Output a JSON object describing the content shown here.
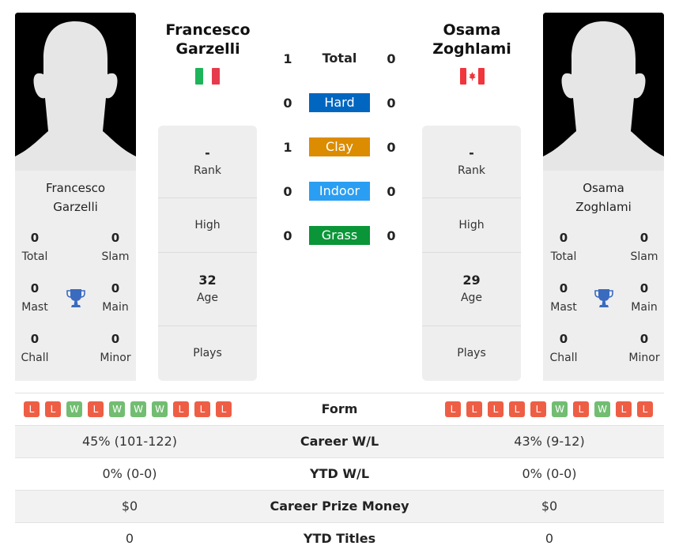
{
  "player1": {
    "first_name": "Francesco",
    "last_name": "Garzelli",
    "country": "Italy",
    "flag_icon": "italy-flag-icon",
    "titles": {
      "total": {
        "value": "0",
        "label": "Total"
      },
      "slam": {
        "value": "0",
        "label": "Slam"
      },
      "mast": {
        "value": "0",
        "label": "Mast"
      },
      "main": {
        "value": "0",
        "label": "Main"
      },
      "chall": {
        "value": "0",
        "label": "Chall"
      },
      "minor": {
        "value": "0",
        "label": "Minor"
      }
    },
    "rank": {
      "value": "-",
      "label": "Rank"
    },
    "high": {
      "value": "",
      "label": "High"
    },
    "age": {
      "value": "32",
      "label": "Age"
    },
    "plays": {
      "value": "",
      "label": "Plays"
    },
    "form": [
      "L",
      "L",
      "W",
      "L",
      "W",
      "W",
      "W",
      "L",
      "L",
      "L"
    ],
    "career_wl": "45% (101-122)",
    "ytd_wl": "0% (0-0)",
    "career_prize": "$0",
    "ytd_titles": "0"
  },
  "player2": {
    "first_name": "Osama",
    "last_name": "Zoghlami",
    "country": "Canada",
    "flag_icon": "canada-flag-icon",
    "titles": {
      "total": {
        "value": "0",
        "label": "Total"
      },
      "slam": {
        "value": "0",
        "label": "Slam"
      },
      "mast": {
        "value": "0",
        "label": "Mast"
      },
      "main": {
        "value": "0",
        "label": "Main"
      },
      "chall": {
        "value": "0",
        "label": "Chall"
      },
      "minor": {
        "value": "0",
        "label": "Minor"
      }
    },
    "rank": {
      "value": "-",
      "label": "Rank"
    },
    "high": {
      "value": "",
      "label": "High"
    },
    "age": {
      "value": "29",
      "label": "Age"
    },
    "plays": {
      "value": "",
      "label": "Plays"
    },
    "form": [
      "L",
      "L",
      "L",
      "L",
      "L",
      "W",
      "L",
      "W",
      "L",
      "L"
    ],
    "career_wl": "43% (9-12)",
    "ytd_wl": "0% (0-0)",
    "career_prize": "$0",
    "ytd_titles": "0"
  },
  "h2h": [
    {
      "label": "Total",
      "p1": "1",
      "p2": "0",
      "color": null
    },
    {
      "label": "Hard",
      "p1": "0",
      "p2": "0",
      "color": "#0066c0"
    },
    {
      "label": "Clay",
      "p1": "1",
      "p2": "0",
      "color": "#dc8c00"
    },
    {
      "label": "Indoor",
      "p1": "0",
      "p2": "0",
      "color": "#2a9ef2"
    },
    {
      "label": "Grass",
      "p1": "0",
      "p2": "0",
      "color": "#0a9538"
    }
  ],
  "rows": {
    "form": "Form",
    "career_wl": "Career W/L",
    "ytd_wl": "YTD W/L",
    "career_prize": "Career Prize Money",
    "ytd_titles": "YTD Titles"
  },
  "colors": {
    "loss": "#ee5e45",
    "win": "#72bd72",
    "trophy": "#3a6bbf"
  }
}
